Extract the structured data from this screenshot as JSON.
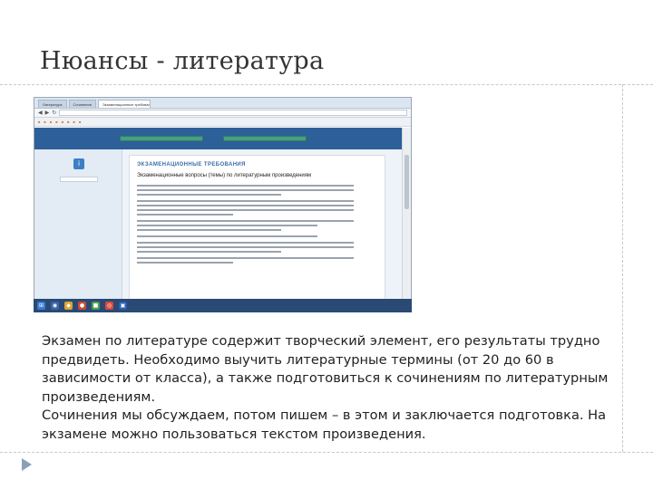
{
  "slide": {
    "title": "Нюансы - литература",
    "body_paragraphs": [
      "Экзамен по литературе содержит творческий элемент, его результаты трудно предвидеть. Необходимо выучить литературные термины (от 20 до 60 в зависимости от класса), а также подготовиться к сочинениям по литературным произведениям.",
      "Сочинения мы обсуждаем, потом пишем – в этом и заключается подготовка. На экзамене можно пользоваться текстом произведения."
    ]
  },
  "screenshot": {
    "browser": {
      "tabs": [
        "Литература",
        "Сочинения",
        "Экзаменационные требования"
      ],
      "nav": {
        "back": "◀",
        "forward": "▶",
        "refresh": "↻"
      },
      "address": "",
      "bookmarks": [
        "",
        "",
        "",
        "",
        "",
        "",
        "",
        ""
      ]
    },
    "site": {
      "header_left": "",
      "header_buttons": [
        "",
        ""
      ],
      "header_right": ""
    },
    "sidebar": {
      "links": [
        "",
        "",
        "",
        ""
      ],
      "badge": "i",
      "note": "",
      "box_title": "",
      "box_lines": [
        "",
        "",
        ""
      ]
    },
    "content": {
      "heading": "ЭКЗАМЕНАЦИОННЫЕ ТРЕБОВАНИЯ",
      "subheading": "Экзаменационные вопросы (темы) по литературным произведениям",
      "back_link": ""
    },
    "taskbar": {
      "icons": [
        "⊞",
        "◉",
        "◆",
        "●",
        "■",
        "◎",
        "▣"
      ],
      "clock": ""
    },
    "colors": {
      "site_header": "#2d5f99",
      "site_button": "#46a083",
      "heading": "#3a6ea8",
      "taskbar": "#2a4a73"
    }
  }
}
